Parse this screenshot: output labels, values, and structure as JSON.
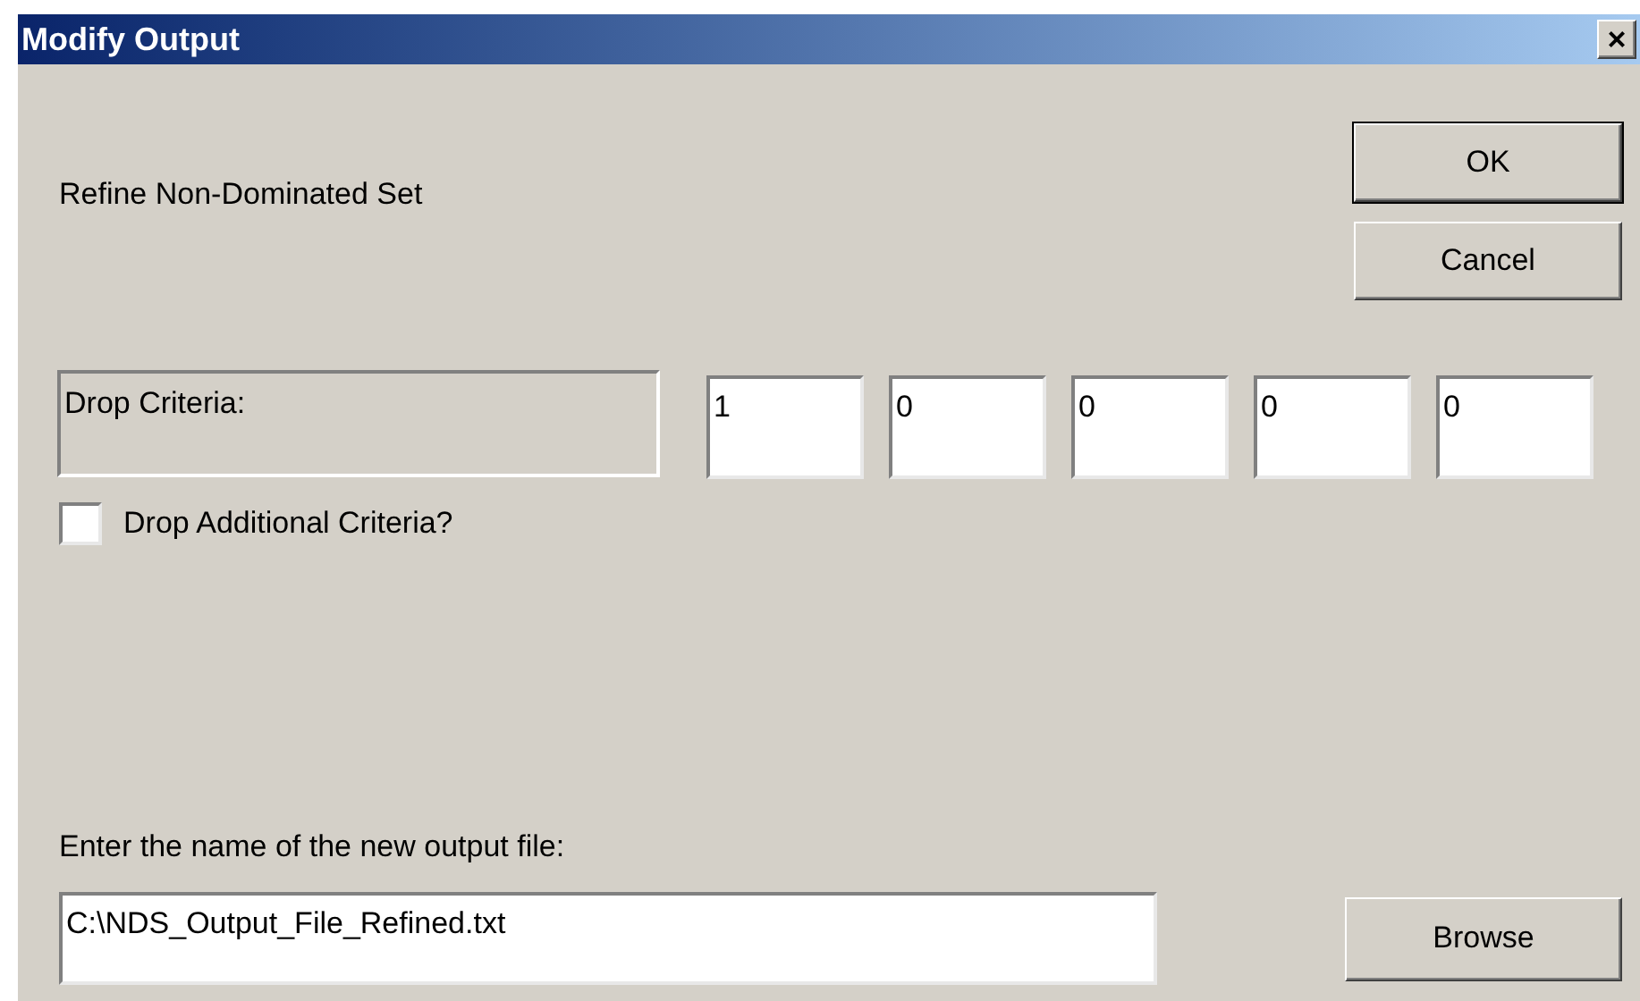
{
  "window": {
    "title": "Modify Output",
    "close": "×"
  },
  "heading": "Refine Non-Dominated Set",
  "buttons": {
    "ok": "OK",
    "cancel": "Cancel",
    "browse": "Browse"
  },
  "drop_criteria": {
    "label": "Drop Criteria:",
    "values": [
      "1",
      "0",
      "0",
      "0",
      "0"
    ]
  },
  "additional": {
    "label": "Drop Additional Criteria?",
    "checked": false
  },
  "output": {
    "label": "Enter the name of the new output file:",
    "value": "C:\\NDS_Output_File_Refined.txt"
  }
}
